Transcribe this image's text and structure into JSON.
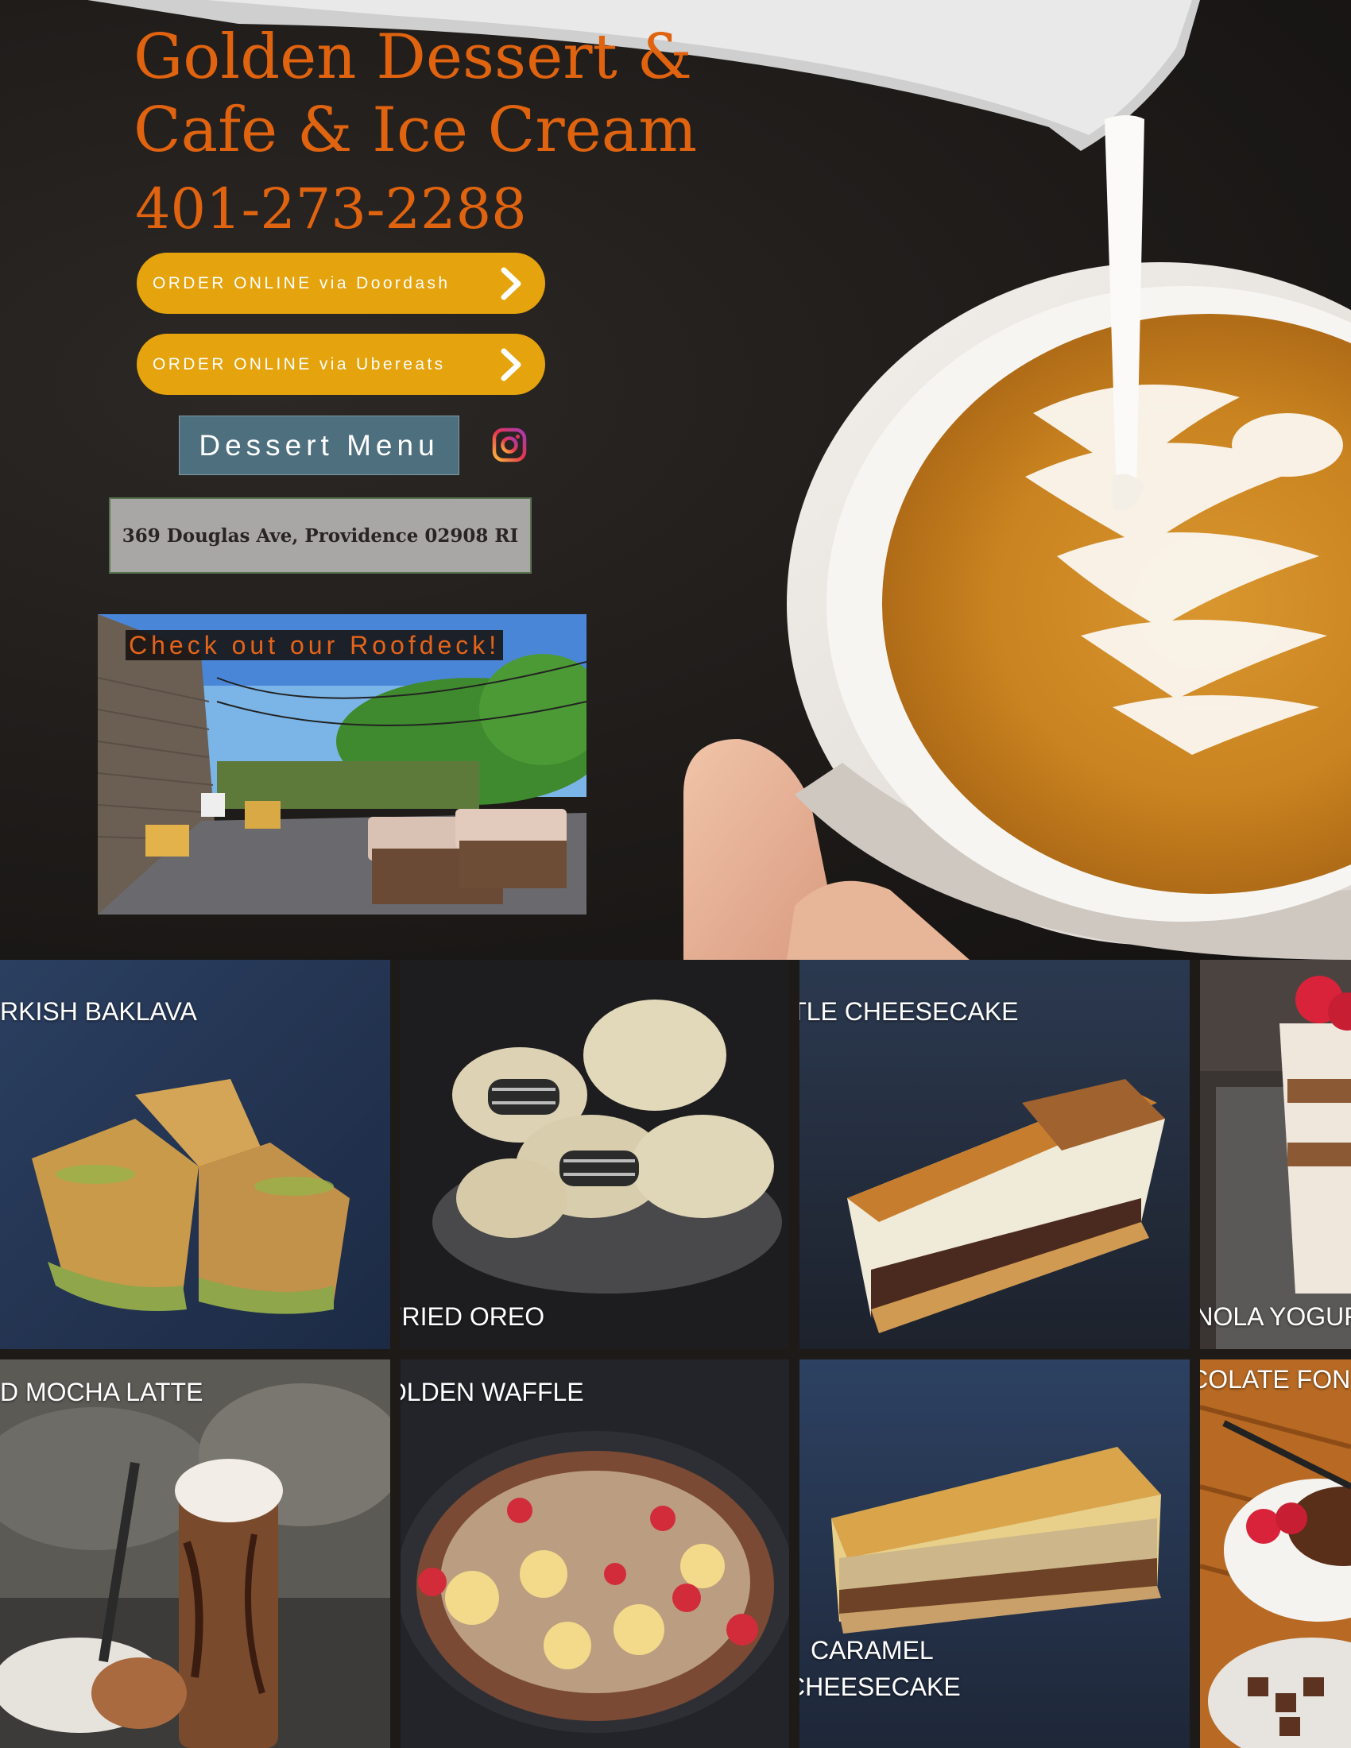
{
  "hero": {
    "title_line1": "Golden Dessert &",
    "title_line2": "Cafe & Ice Cream",
    "phone": "401-273-2288",
    "order_doordash_label": "ORDER ONLINE via Doordash",
    "order_ubereats_label": "ORDER ONLINE via Ubereats",
    "dessert_menu_label": "Dessert Menu",
    "address": "369 Douglas Ave, Providence 02908 RI",
    "roofdeck_label": "Check out our Roofdeck!",
    "icons": [
      "chevron-right-icon",
      "instagram-icon"
    ]
  },
  "gallery": {
    "row1": [
      "RKISH BAKLAVA",
      "FRIED OREO",
      "TURTLE CHEESECAKE",
      "GRANOLA YOGUR"
    ],
    "row2": [
      "D MOCHA LATTE",
      "GOLDEN WAFFLE",
      "CARAMEL",
      "CHEESECAKE",
      "CHOCOLATE FON"
    ]
  },
  "colors": {
    "accent_orange": "#e0630f",
    "button_gold": "#e5a30d",
    "menu_teal": "#4d6f7e",
    "address_gray": "#a8a7a6"
  }
}
